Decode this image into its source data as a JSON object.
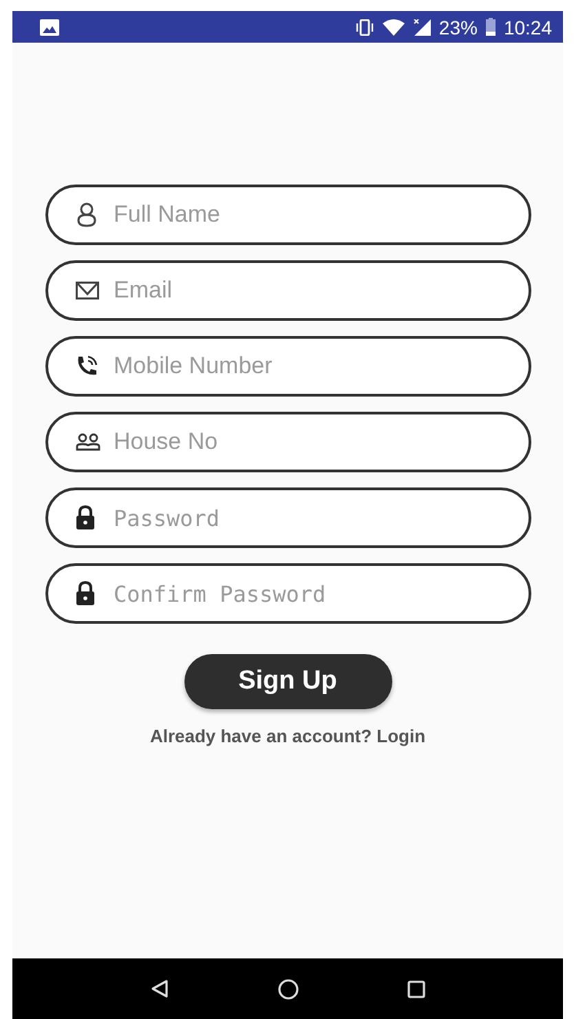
{
  "status_bar": {
    "battery": "23%",
    "time": "10:24"
  },
  "fields": [
    {
      "kind": "name",
      "placeholder": "Full Name"
    },
    {
      "kind": "email",
      "placeholder": "Email"
    },
    {
      "kind": "phone",
      "placeholder": "Mobile Number"
    },
    {
      "kind": "house",
      "placeholder": "House No"
    },
    {
      "kind": "password",
      "placeholder": "Password"
    },
    {
      "kind": "password",
      "placeholder": "Confirm Password"
    }
  ],
  "submit": "Sign Up",
  "login_link": "Already have an account? Login"
}
